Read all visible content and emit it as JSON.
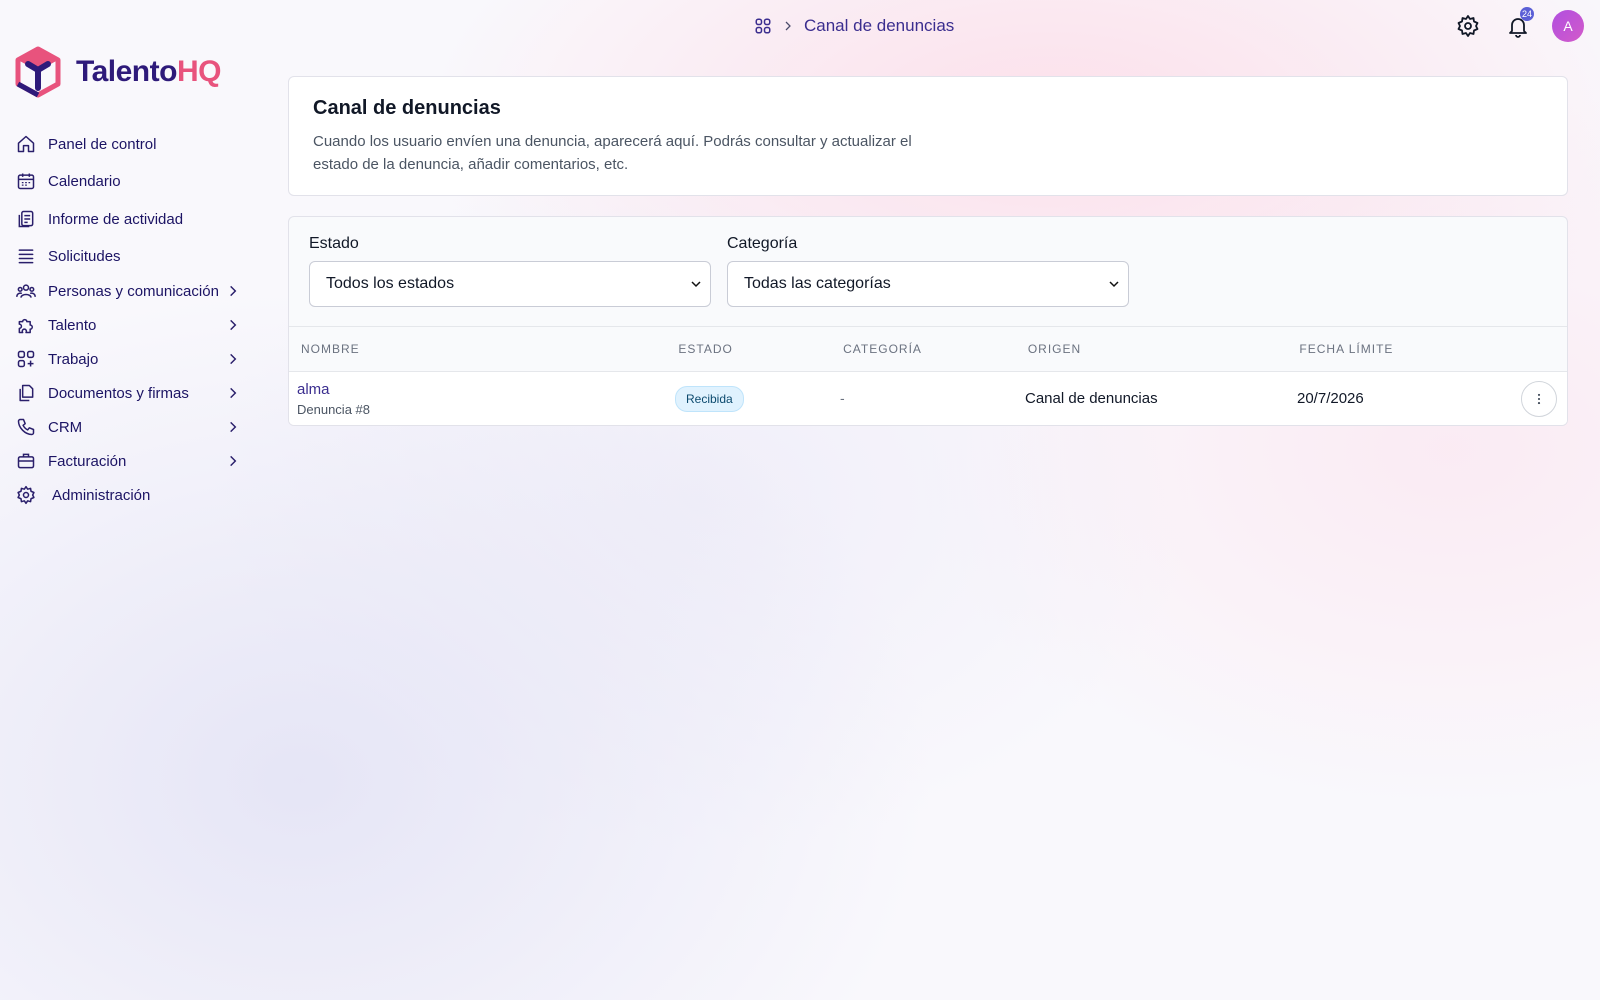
{
  "app": {
    "brand_part1": "Talento",
    "brand_part2": "HQ",
    "brand_colors": {
      "primary": "#2e1a7a",
      "accent": "#e8537d"
    }
  },
  "sidebar": {
    "items": [
      {
        "label": "Panel de control",
        "icon": "home-icon",
        "has_submenu": false
      },
      {
        "label": "Calendario",
        "icon": "calendar-icon",
        "has_submenu": false
      },
      {
        "label": "Informe de actividad",
        "icon": "clipboard-icon",
        "has_submenu": false
      },
      {
        "label": "Solicitudes",
        "icon": "stack-icon",
        "has_submenu": false
      },
      {
        "label": "Personas y comunicación",
        "icon": "users-icon",
        "has_submenu": true
      },
      {
        "label": "Talento",
        "icon": "puzzle-icon",
        "has_submenu": true
      },
      {
        "label": "Trabajo",
        "icon": "grid-plus-icon",
        "has_submenu": true
      },
      {
        "label": "Documentos y firmas",
        "icon": "documents-icon",
        "has_submenu": true
      },
      {
        "label": "CRM",
        "icon": "phone-icon",
        "has_submenu": true
      },
      {
        "label": "Facturación",
        "icon": "briefcase-icon",
        "has_submenu": true
      },
      {
        "label": "Administración",
        "icon": "gear-icon",
        "has_submenu": false
      }
    ]
  },
  "header": {
    "breadcrumb_current": "Canal de denuncias",
    "notification_count": "24",
    "avatar_initial": "A"
  },
  "page": {
    "title": "Canal de denuncias",
    "description": "Cuando los usuario envíen una denuncia, aparecerá aquí. Podrás consultar y actualizar el estado de la denuncia, añadir comentarios, etc."
  },
  "filters": {
    "estado_label": "Estado",
    "estado_value": "Todos los estados",
    "categoria_label": "Categoría",
    "categoria_value": "Todas las categorías"
  },
  "table": {
    "columns": [
      "NOMBRE",
      "ESTADO",
      "CATEGORÍA",
      "ORIGEN",
      "FECHA LÍMITE"
    ],
    "rows": [
      {
        "name": "alma",
        "subtitle": "Denuncia #8",
        "estado": "Recibida",
        "categoria": "-",
        "origen": "Canal de denuncias",
        "fecha_limite": "20/7/2026"
      }
    ]
  }
}
